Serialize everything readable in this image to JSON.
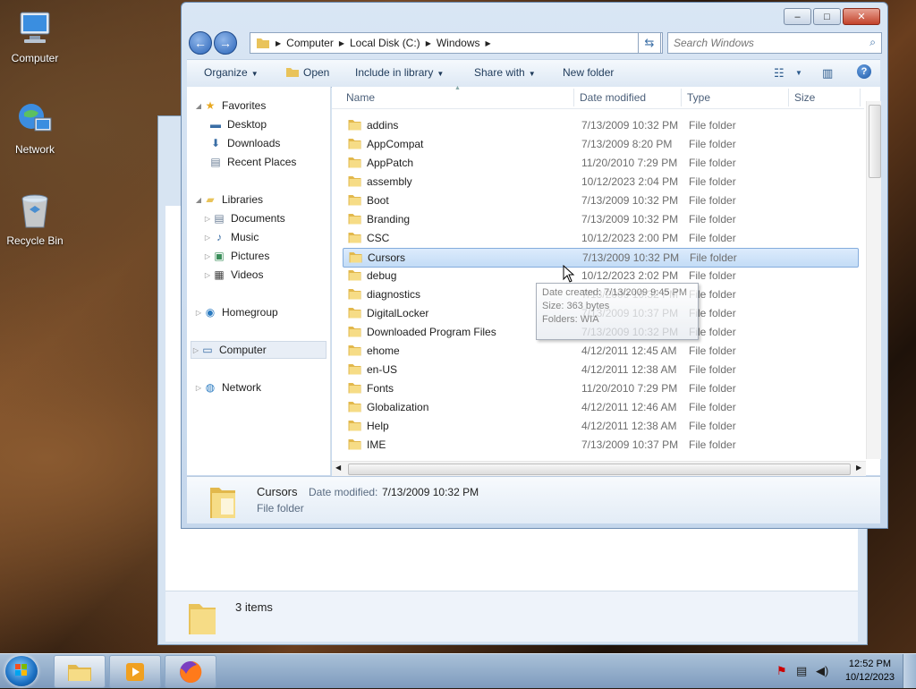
{
  "desktop": {
    "icons": [
      {
        "label": "Computer",
        "icon": "computer-icon"
      },
      {
        "label": "Network",
        "icon": "network-icon"
      },
      {
        "label": "Recycle Bin",
        "icon": "recycle-bin-icon"
      }
    ]
  },
  "background_window": {
    "status_count": "3 items"
  },
  "window": {
    "caption_buttons": {
      "minimize": "–",
      "maximize": "□",
      "close": "✕"
    },
    "address": {
      "segments": [
        "Computer",
        "Local Disk (C:)",
        "Windows"
      ]
    },
    "search": {
      "placeholder": "Search Windows"
    },
    "toolbar": {
      "organize": "Organize",
      "open": "Open",
      "include_in_library": "Include in library",
      "share_with": "Share with",
      "new_folder": "New folder"
    },
    "nav_pane": {
      "favorites": "Favorites",
      "desktop": "Desktop",
      "downloads": "Downloads",
      "recent_places": "Recent Places",
      "libraries": "Libraries",
      "documents": "Documents",
      "music": "Music",
      "pictures": "Pictures",
      "videos": "Videos",
      "homegroup": "Homegroup",
      "computer": "Computer",
      "network": "Network"
    },
    "columns": {
      "name": "Name",
      "date_modified": "Date modified",
      "type": "Type",
      "size": "Size"
    },
    "files": [
      {
        "name": "addins",
        "date": "7/13/2009 10:32 PM",
        "type": "File folder"
      },
      {
        "name": "AppCompat",
        "date": "7/13/2009 8:20 PM",
        "type": "File folder"
      },
      {
        "name": "AppPatch",
        "date": "11/20/2010 7:29 PM",
        "type": "File folder"
      },
      {
        "name": "assembly",
        "date": "10/12/2023 2:04 PM",
        "type": "File folder"
      },
      {
        "name": "Boot",
        "date": "7/13/2009 10:32 PM",
        "type": "File folder"
      },
      {
        "name": "Branding",
        "date": "7/13/2009 10:32 PM",
        "type": "File folder"
      },
      {
        "name": "CSC",
        "date": "10/12/2023 2:00 PM",
        "type": "File folder"
      },
      {
        "name": "Cursors",
        "date": "7/13/2009 10:32 PM",
        "type": "File folder",
        "selected": true
      },
      {
        "name": "debug",
        "date": "10/12/2023 2:02 PM",
        "type": "File folder"
      },
      {
        "name": "diagnostics",
        "date": "7/13/2009 10:32 PM",
        "type": "File folder"
      },
      {
        "name": "DigitalLocker",
        "date": "7/13/2009 10:37 PM",
        "type": "File folder"
      },
      {
        "name": "Downloaded Program Files",
        "date": "7/13/2009 10:32 PM",
        "type": "File folder"
      },
      {
        "name": "ehome",
        "date": "4/12/2011 12:45 AM",
        "type": "File folder"
      },
      {
        "name": "en-US",
        "date": "4/12/2011 12:38 AM",
        "type": "File folder"
      },
      {
        "name": "Fonts",
        "date": "11/20/2010 7:29 PM",
        "type": "File folder"
      },
      {
        "name": "Globalization",
        "date": "4/12/2011 12:46 AM",
        "type": "File folder"
      },
      {
        "name": "Help",
        "date": "4/12/2011 12:38 AM",
        "type": "File folder"
      },
      {
        "name": "IME",
        "date": "7/13/2009 10:37 PM",
        "type": "File folder"
      }
    ],
    "tooltip": {
      "line1": "Date created: 7/13/2009 9:45 PM",
      "line2": "Size: 363 bytes",
      "line3": "Folders: WIA"
    },
    "details": {
      "name": "Cursors",
      "date_label": "Date modified:",
      "date_value": "7/13/2009 10:32 PM",
      "type": "File folder"
    }
  },
  "taskbar": {
    "clock_time": "12:52 PM",
    "clock_date": "10/12/2023"
  },
  "colors": {
    "selection_bg": "#cfe3fa",
    "accent": "#2a64b8"
  }
}
